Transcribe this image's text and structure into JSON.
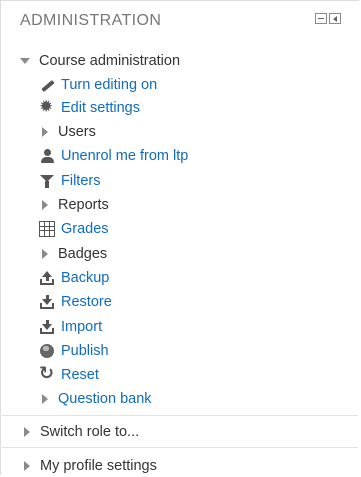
{
  "header": {
    "title": "ADMINISTRATION"
  },
  "course_admin": {
    "label": "Course administration",
    "items": [
      {
        "label": "Turn editing on",
        "icon": "pencil-icon",
        "kind": "link"
      },
      {
        "label": "Edit settings",
        "icon": "gear-icon",
        "kind": "link"
      },
      {
        "label": "Users",
        "icon": "expand-arrow-icon",
        "kind": "branch"
      },
      {
        "label": "Unenrol me from ltp",
        "icon": "user-icon",
        "kind": "link"
      },
      {
        "label": "Filters",
        "icon": "filter-icon",
        "kind": "link"
      },
      {
        "label": "Reports",
        "icon": "expand-arrow-icon",
        "kind": "branch"
      },
      {
        "label": "Grades",
        "icon": "grades-table-icon",
        "kind": "link"
      },
      {
        "label": "Badges",
        "icon": "expand-arrow-icon",
        "kind": "branch"
      },
      {
        "label": "Backup",
        "icon": "backup-icon",
        "kind": "link"
      },
      {
        "label": "Restore",
        "icon": "restore-icon",
        "kind": "link"
      },
      {
        "label": "Import",
        "icon": "import-icon",
        "kind": "link"
      },
      {
        "label": "Publish",
        "icon": "globe-icon",
        "kind": "link"
      },
      {
        "label": "Reset",
        "icon": "reset-icon",
        "kind": "link"
      },
      {
        "label": "Question bank",
        "icon": "expand-arrow-icon",
        "kind": "branch"
      }
    ]
  },
  "switch_role": {
    "label": "Switch role to..."
  },
  "profile_settings": {
    "label": "My profile settings"
  },
  "colors": {
    "link": "#0f6cbf",
    "text": "#333333",
    "header": "#777777"
  }
}
